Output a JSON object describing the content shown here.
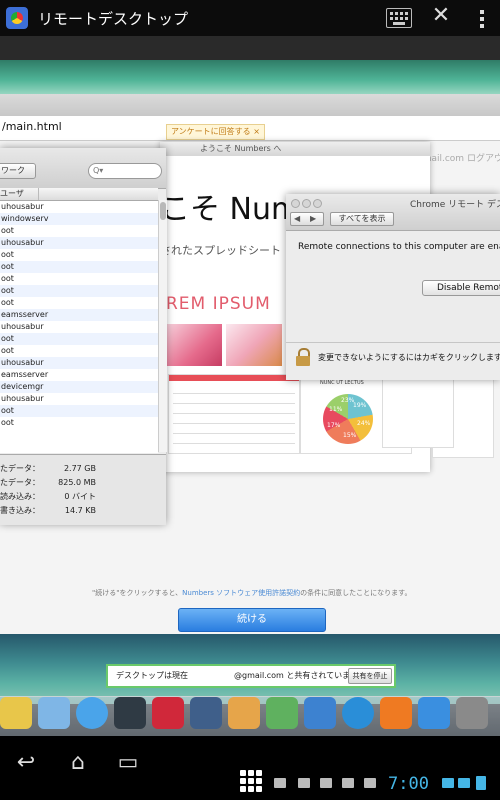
{
  "topbar": {
    "title": "リモートデスクトップ",
    "keyboard_icon": "keyboard-icon",
    "close_icon": "close-icon",
    "menu_icon": "menu-dots-icon"
  },
  "browser": {
    "url": "/main.html",
    "signin": "@gmail.com ログアウト |"
  },
  "numbers": {
    "title": "ようこそ Numbers へ",
    "hint": "アンケートに回答する ×",
    "welcome": "こそ Num",
    "subtitle": "されたスプレッドシート",
    "lorem": "REM  IPSUM",
    "pie_title": "NUNC UT LECTUS",
    "pie_labels": [
      "19%",
      "24%",
      "15%",
      "17%",
      "11%",
      "23%"
    ],
    "agree_prefix": "\"続ける\"をクリックすると、",
    "agree_link": "Numbers ソフトウェア使用許諾契約",
    "agree_suffix": "の条件に同意したことになります。",
    "continue": "続ける"
  },
  "activity": {
    "network_tab": "ワーク",
    "search_placeholder": "Q▾",
    "column_user": "ユーザ",
    "processes": [
      "uhousabur",
      "windowserv",
      "oot",
      "uhousabur",
      "oot",
      "oot",
      "oot",
      "oot",
      "oot",
      "eamsserver",
      "uhousabur",
      "oot",
      "oot",
      "uhousabur",
      "eamsserver",
      "devicemgr",
      "uhousabur",
      "oot",
      "oot"
    ],
    "stats": [
      {
        "label": "たデータ：",
        "value": "2.77 GB"
      },
      {
        "label": "たデータ：",
        "value": "825.0 MB"
      },
      {
        "label": "読み込み：",
        "value": "0 バイト"
      },
      {
        "label": "書き込み：",
        "value": "14.7 KB"
      }
    ]
  },
  "prefs": {
    "title": "Chrome リモート デスク",
    "back": "◀",
    "forward": "▶",
    "show_all": "すべてを表示",
    "message": "Remote connections to this computer are enabled.",
    "disable_button": "Disable Remote",
    "lock_text": "変更できないようにするにはカギをクリックします。"
  },
  "share": {
    "text": "デスクトップは現在",
    "email": "@gmail.com と共有されています。",
    "stop": "共有を停止"
  },
  "dock": {
    "icons": [
      "stickies-icon",
      "preview-icon",
      "messages-icon",
      "facetime-icon",
      "photo-booth-icon",
      "iphoto-icon",
      "pages-icon",
      "numbers-icon",
      "keynote-icon",
      "itunes-icon",
      "ibooks-icon",
      "app-store-icon",
      "system-preferences-icon"
    ],
    "colors": [
      "#e8c64a",
      "#7fb6e6",
      "#4aa4ea",
      "#2f3a44",
      "#d0283a",
      "#3f5f8a",
      "#e6a54a",
      "#5fb15f",
      "#3d82d0",
      "#2a8ed8",
      "#ef7a22",
      "#3a8fe0",
      "#8a8a8a"
    ]
  },
  "statusbar": {
    "time": "7:00",
    "back_icon": "back-icon",
    "home_icon": "home-icon",
    "recents_icon": "recent-apps-icon"
  }
}
